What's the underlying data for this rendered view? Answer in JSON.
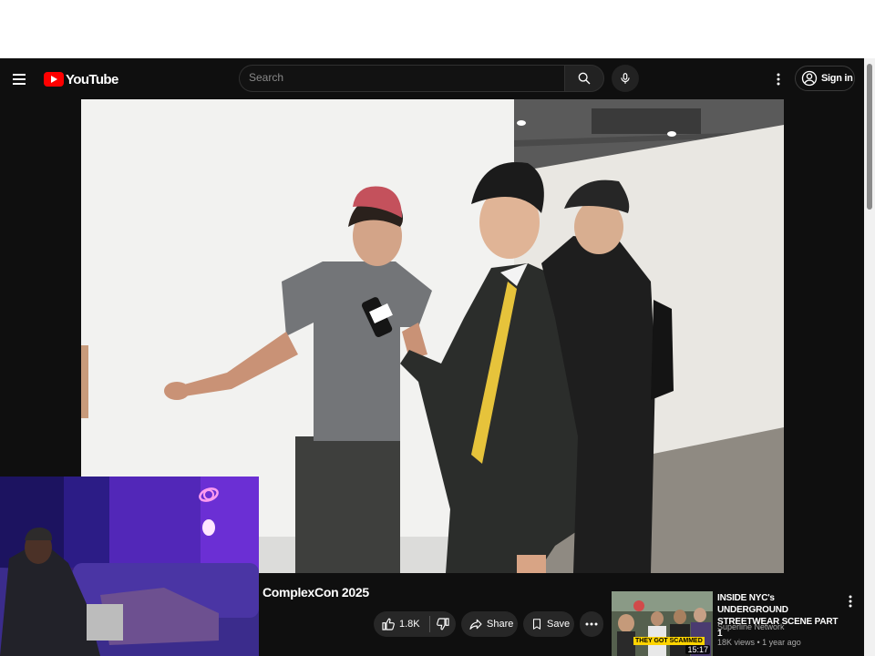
{
  "app": {
    "name": "YouTube"
  },
  "search": {
    "placeholder": "Search"
  },
  "header": {
    "sign_in_label": "Sign in"
  },
  "video": {
    "title": "ComplexCon 2025",
    "like_count": "1.8K",
    "share_label": "Share",
    "save_label": "Save"
  },
  "recommendation": {
    "title": "INSIDE NYC's UNDERGROUND STREETWEAR SCENE PART 1",
    "channel": "Superline Network",
    "meta": "18K views • 1 year ago",
    "duration": "15:17",
    "thumb_text": "THEY GOT SCAMMED"
  },
  "colors": {
    "brand": "#ff0000",
    "background": "#0f0f0f",
    "pill": "#272727"
  }
}
